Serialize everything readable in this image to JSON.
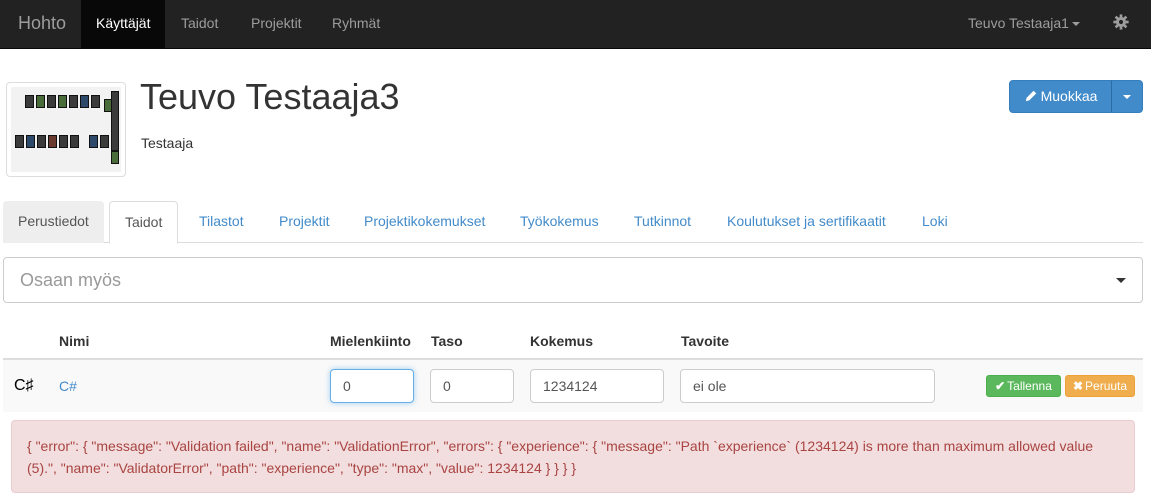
{
  "navbar": {
    "brand": "Hohto",
    "items": [
      {
        "label": "Käyttäjät",
        "active": true
      },
      {
        "label": "Taidot",
        "active": false
      },
      {
        "label": "Projektit",
        "active": false
      },
      {
        "label": "Ryhmät",
        "active": false
      }
    ],
    "user_label": "Teuvo Testaaja1",
    "settings_icon": "gear-icon"
  },
  "profile": {
    "name": "Teuvo Testaaja3",
    "role": "Testaaja",
    "edit_label": "Muokkaa"
  },
  "tabs": [
    {
      "label": "Perustiedot"
    },
    {
      "label": "Taidot",
      "active": true
    },
    {
      "label": "Tilastot"
    },
    {
      "label": "Projektit"
    },
    {
      "label": "Projektikokemukset"
    },
    {
      "label": "Työkokemus"
    },
    {
      "label": "Tutkinnot"
    },
    {
      "label": "Koulutukset ja sertifikaatit"
    },
    {
      "label": "Loki"
    }
  ],
  "skill_select": {
    "placeholder": "Osaan myös"
  },
  "table": {
    "headers": {
      "name": "Nimi",
      "interest": "Mielenkiinto",
      "level": "Taso",
      "experience": "Kokemus",
      "goal": "Tavoite"
    },
    "row": {
      "icon_text": "C♯",
      "name": "C#",
      "interest": "0",
      "level": "0",
      "experience": "1234124",
      "goal": "ei ole",
      "save_label": "Tallenna",
      "cancel_label": "Peruuta"
    }
  },
  "error_alert": {
    "text": "{ \"error\": { \"message\": \"Validation failed\", \"name\": \"ValidationError\", \"errors\": { \"experience\": { \"message\": \"Path `experience` (1234124) is more than maximum allowed value (5).\", \"name\": \"ValidatorError\", \"path\": \"experience\", \"type\": \"max\", \"value\": 1234124 } } } }"
  },
  "colors": {
    "navbar_bg": "#222222",
    "primary": "#428bca",
    "success": "#5cb85c",
    "warning": "#f0ad4e",
    "danger_bg": "#f2dede",
    "danger_text": "#a94442"
  }
}
